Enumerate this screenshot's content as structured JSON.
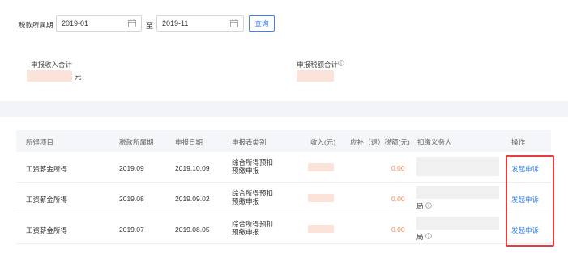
{
  "filter": {
    "label": "税款所属期",
    "start": "2019-01",
    "to": "至",
    "end": "2019-11",
    "query": "查询"
  },
  "summary": {
    "income_label": "申报收入合计",
    "income_unit": "元",
    "tax_label": "申报税额合计"
  },
  "table": {
    "headers": [
      "所得项目",
      "税款所属期",
      "申报日期",
      "申报表类别",
      "收入(元)",
      "应补（退）税额(元)",
      "扣缴义务人",
      "操作"
    ],
    "rows": [
      {
        "item": "工资薪金所得",
        "period": "2019.09",
        "date": "2019.10.09",
        "type1": "综合所得预扣",
        "type2": "预缴申报",
        "tax": "0.00",
        "payer_suffix": "",
        "action": "发起申诉"
      },
      {
        "item": "工资薪金所得",
        "period": "2019.08",
        "date": "2019.09.02",
        "type1": "综合所得预扣",
        "type2": "预缴申报",
        "tax": "0.00",
        "payer_suffix": "局",
        "action": "发起申诉"
      },
      {
        "item": "工资薪金所得",
        "period": "2019.07",
        "date": "2019.08.05",
        "type1": "综合所得预扣",
        "type2": "预缴申报",
        "tax": "0.00",
        "payer_suffix": "局",
        "action": "发起申诉"
      }
    ]
  }
}
